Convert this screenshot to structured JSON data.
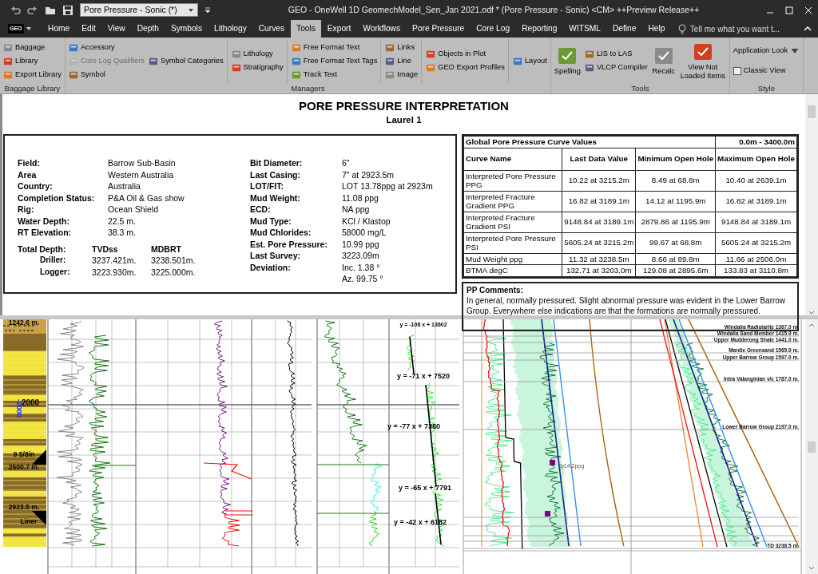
{
  "window": {
    "title": "GEO - OneWell 1D GeomechModel_Sen_Jan 2021.odf * (Pore Pressure - Sonic) <CM> ++Preview Release++",
    "layout_combo": "Pore Pressure - Sonic (*)"
  },
  "menu": {
    "app_button": "GEO",
    "tabs": [
      {
        "label": "Home",
        "selected": false
      },
      {
        "label": "Edit",
        "selected": false
      },
      {
        "label": "View",
        "selected": false
      },
      {
        "label": "Depth",
        "selected": false
      },
      {
        "label": "Symbols",
        "selected": false
      },
      {
        "label": "Lithology",
        "selected": false
      },
      {
        "label": "Curves",
        "selected": false
      },
      {
        "label": "Tools",
        "selected": true
      },
      {
        "label": "Export",
        "selected": false
      },
      {
        "label": "Workflows",
        "selected": false
      },
      {
        "label": "Pore Pressure",
        "selected": false
      },
      {
        "label": "Core Log",
        "selected": false
      },
      {
        "label": "Reporting",
        "selected": false
      },
      {
        "label": "WITSML",
        "selected": false
      },
      {
        "label": "Define",
        "selected": false
      },
      {
        "label": "Help",
        "selected": false
      }
    ],
    "search": {
      "placeholder": "Tell me what you want t..."
    }
  },
  "ribbon": {
    "groups": [
      {
        "label": "Baggage Library",
        "columns": [
          [
            {
              "label": "Baggage",
              "kind": "small",
              "disabled": false
            },
            {
              "label": "Library",
              "kind": "small",
              "disabled": false
            },
            {
              "label": "Export Library",
              "kind": "small",
              "disabled": false
            }
          ]
        ]
      },
      {
        "label": "Managers",
        "columns": [
          [
            {
              "label": "Accessory",
              "kind": "small",
              "disabled": false
            },
            {
              "label": "Core Log Qualifiers",
              "kind": "small",
              "disabled": true
            },
            {
              "label": "Symbol",
              "kind": "small",
              "disabled": false
            }
          ],
          [
            {
              "label": "Symbol Categories",
              "kind": "small",
              "disabled": false
            }
          ],
          [
            {
              "label": "Lithology",
              "kind": "small",
              "disabled": false
            },
            {
              "label": "Stratigraphy",
              "kind": "small",
              "disabled": false
            }
          ],
          [
            {
              "label": "Free Format Text",
              "kind": "small",
              "disabled": false
            },
            {
              "label": "Free Format Text Tags",
              "kind": "small",
              "disabled": false
            },
            {
              "label": "Track Text",
              "kind": "small",
              "disabled": false
            }
          ],
          [
            {
              "label": "Links",
              "kind": "small",
              "disabled": false
            },
            {
              "label": "Line",
              "kind": "small",
              "disabled": false
            },
            {
              "label": "Image",
              "kind": "small",
              "disabled": false
            }
          ],
          [
            {
              "label": "Objects in Plot",
              "kind": "small",
              "disabled": false
            },
            {
              "label": "GEO Export Profiles",
              "kind": "small",
              "disabled": false
            }
          ],
          [
            {
              "label": "Layout",
              "kind": "small",
              "disabled": false
            }
          ]
        ]
      },
      {
        "label": "Tools",
        "columns": [
          [
            {
              "label": "Spelling",
              "kind": "large",
              "disabled": false
            }
          ],
          [
            {
              "label": "LIS to LAS",
              "kind": "small",
              "disabled": false
            },
            {
              "label": "VLCP Compiler",
              "kind": "small",
              "disabled": false
            }
          ],
          [
            {
              "label": "Recalc",
              "kind": "large",
              "disabled": false
            }
          ],
          [
            {
              "label": "View Not Loaded Items",
              "kind": "large",
              "disabled": false
            }
          ]
        ]
      },
      {
        "label": "Style",
        "columns": [
          [
            {
              "label": "Application Look",
              "kind": "dropdown",
              "disabled": false
            },
            {
              "label": "Classic View",
              "kind": "checkbox",
              "checked": false,
              "disabled": false
            }
          ]
        ]
      }
    ]
  },
  "report": {
    "title": "PORE PRESSURE INTERPRETATION",
    "subtitle": "Laurel 1",
    "info_left": [
      {
        "label": "Field:",
        "value": "Barrow Sub-Basin"
      },
      {
        "label": "Area",
        "value": "Western Australia"
      },
      {
        "label": "Country:",
        "value": "Australia"
      },
      {
        "label": "Completion Status:",
        "value": "P&A Oil & Gas show"
      },
      {
        "label": "Rig:",
        "value": "Ocean Shield"
      },
      {
        "label": "Water Depth:",
        "value": "22.5 m."
      },
      {
        "label": "RT Elevation:",
        "value": "38.3 m."
      }
    ],
    "total_depth": {
      "label": "Total Depth:",
      "columns": [
        "TVDss",
        "MDBRT"
      ],
      "rows": [
        {
          "label": "Driller:",
          "tvdss": "3237.421m.",
          "mdbrt": "3238.501m."
        },
        {
          "label": "Logger:",
          "tvdss": "3223.930m.",
          "mdbrt": "3225.000m."
        }
      ]
    },
    "info_right": [
      {
        "label": "Bit Diameter:",
        "value": "6\""
      },
      {
        "label": "Last Casing:",
        "value": "7\" at 2923.5m"
      },
      {
        "label": "LOT/FIT:",
        "value": "LOT 13.78ppg at 2923m"
      },
      {
        "label": "Mud Weight:",
        "value": "11.08 ppg"
      },
      {
        "label": "ECD:",
        "value": "NA ppg"
      },
      {
        "label": "Mud Type:",
        "value": "KCl / Klastop"
      },
      {
        "label": "Mud Chlorides:",
        "value": "58000 mg/L"
      },
      {
        "label": "Est. Pore Pressure:",
        "value": "10.99 ppg"
      },
      {
        "label": "Last Survey:",
        "value": "3223.09m"
      },
      {
        "label": "Deviation:",
        "value": "Inc. 1.38 °"
      },
      {
        "value": "Az. 99.75 °"
      }
    ],
    "curve_table": {
      "title": "Global Pore Pressure Curve Values",
      "range": "0.0m - 3400.0m",
      "columns": [
        "Curve Name",
        "Last Data Value",
        "Minimum Open Hole",
        "Maximum Open Hole"
      ],
      "rows": [
        [
          "Interpreted Pore Pressure PPG",
          "10.22 at 3215.2m",
          "8.49 at 68.8m",
          "10.40 at 2639.1m"
        ],
        [
          "Interpreted Fracture Gradient PPG",
          "16.82 at 3189.1m",
          "14.12 at 1195.9m",
          "16.82 at 3189.1m"
        ],
        [
          "Interpreted Fracture Gradient PSI",
          "9148.84 at 3189.1m",
          "2879.86 at 1195.9m",
          "9148.84 at 3189.1m"
        ],
        [
          "Interpreted Pore Pressure PSI",
          "5605.24 at 3215.2m",
          "99.67 at 68.8m",
          "5605.24 at 3215.2m"
        ],
        [
          "Mud Weight ppg",
          "11.32 at 3238.5m",
          "8.66 at 89.8m",
          "11.66 at 2506.0m"
        ],
        [
          "BTMA degC",
          "132.71 at 3203.0m",
          "129.08 at 2895.6m",
          "133.83 at 3110.8m"
        ]
      ]
    },
    "comments": {
      "label": "PP Comments:",
      "text": "In general, normally pressured. Slight abnormal pressure was evident in the Lower Barrow Group. Everywhere else indications are that the formations are normally pressured."
    }
  },
  "log_plot": {
    "lithology_labels": [
      "1242.6 m.",
      "2000",
      "9 5/8in",
      "2500.7 m.",
      "2923.5 m.",
      "Liner"
    ],
    "depth_axis_label": "-2000",
    "equations": [
      "y = -108 x + 13602",
      "y = -71 x + 7520",
      "y = -77 x + 7380",
      "y = -65 x + 7791",
      "y = -42 x + 6182"
    ],
    "point_labels": [
      "tp14.2ppg"
    ],
    "formation_tops": [
      "Windalia Radiolarite 1367.0 m.",
      "Windalia Sand Member 1415.9 m.",
      "Upper Mudderong Shale 1441.0 m.",
      "Mardie Greensand 1565.9 m.",
      "Upper Barrow Group 1597.0 m.",
      "Intra Valanginian v/c 1787.0 m.",
      "Lower Barrow Group 2197.0 m.",
      "TD 3238.5 m."
    ]
  }
}
